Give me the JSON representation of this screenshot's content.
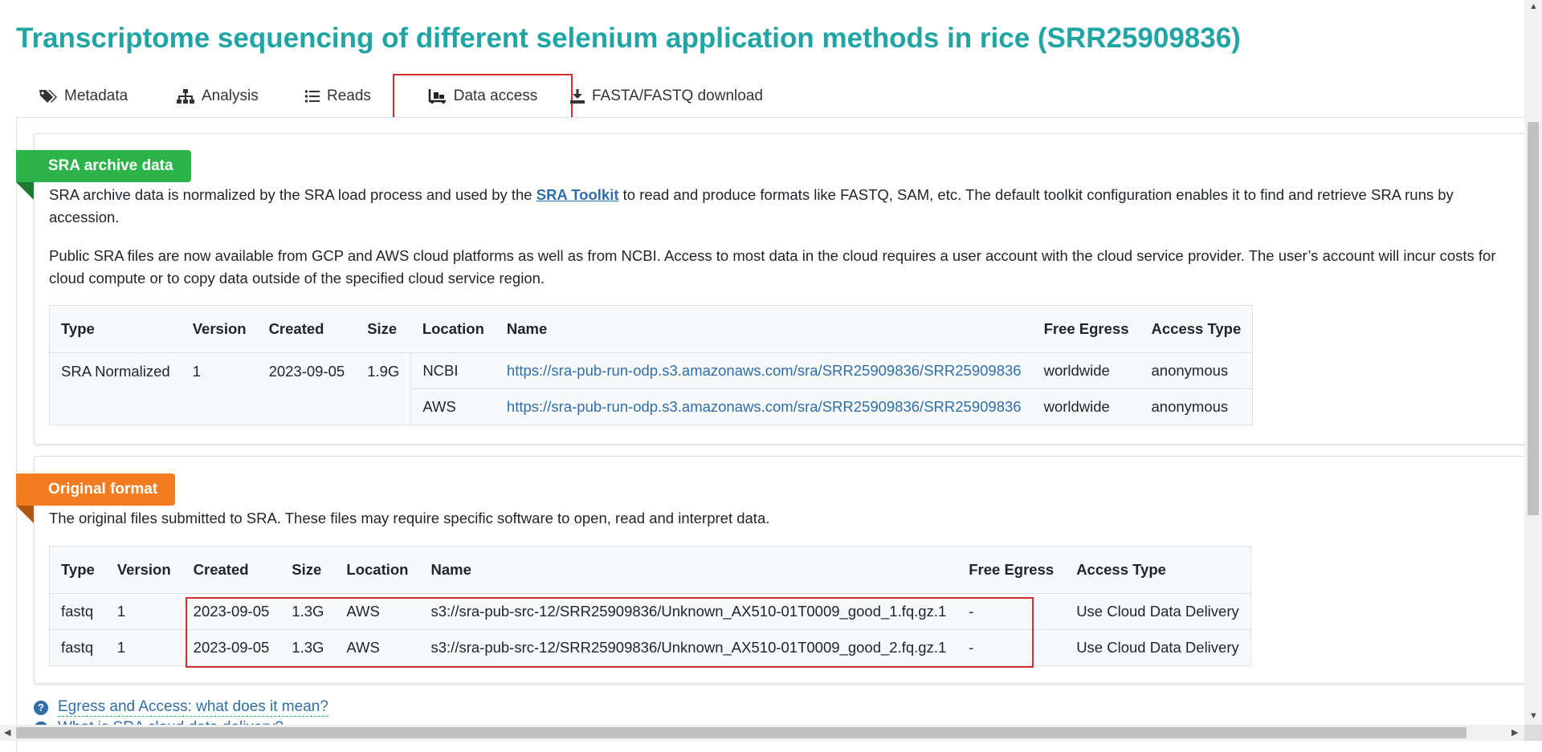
{
  "page": {
    "title": "Transcriptome sequencing of different selenium application methods in rice (SRR25909836)"
  },
  "tabs": [
    {
      "label": "Metadata",
      "icon": "tags-icon"
    },
    {
      "label": "Analysis",
      "icon": "sitemap-icon"
    },
    {
      "label": "Reads",
      "icon": "list-icon"
    },
    {
      "label": "Data access",
      "icon": "dolly-icon",
      "active": true
    },
    {
      "label": "FASTA/FASTQ download",
      "icon": "download-icon"
    }
  ],
  "sra": {
    "badge": "SRA archive data",
    "para1_before": "SRA archive data is normalized by the SRA load process and used by the ",
    "para1_link": "SRA Toolkit",
    "para1_after": " to read and produce formats like FASTQ, SAM, etc. The default toolkit configuration enables it to find and retrieve SRA runs by accession.",
    "para2": "Public SRA files are now available from GCP and AWS cloud platforms as well as from NCBI. Access to most data in the cloud requires a user account with the cloud service provider. The user’s account will incur costs for cloud compute or to copy data outside of the specified cloud service region.",
    "headers": [
      "Type",
      "Version",
      "Created",
      "Size",
      "Location",
      "Name",
      "Free Egress",
      "Access Type"
    ],
    "type": "SRA Normalized",
    "version": "1",
    "created": "2023-09-05",
    "size": "1.9G",
    "rows": [
      {
        "location": "NCBI",
        "name": "https://sra-pub-run-odp.s3.amazonaws.com/sra/SRR25909836/SRR25909836",
        "egress": "worldwide",
        "access": "anonymous"
      },
      {
        "location": "AWS",
        "name": "https://sra-pub-run-odp.s3.amazonaws.com/sra/SRR25909836/SRR25909836",
        "egress": "worldwide",
        "access": "anonymous"
      }
    ]
  },
  "original": {
    "badge": "Original format",
    "para": "The original files submitted to SRA. These files may require specific software to open, read and interpret data.",
    "headers": [
      "Type",
      "Version",
      "Created",
      "Size",
      "Location",
      "Name",
      "Free Egress",
      "Access Type"
    ],
    "rows": [
      {
        "type": "fastq",
        "version": "1",
        "created": "2023-09-05",
        "size": "1.3G",
        "location": "AWS",
        "name": "s3://sra-pub-src-12/SRR25909836/Unknown_AX510-01T0009_good_1.fq.gz.1",
        "egress": "-",
        "access": "Use Cloud Data Delivery"
      },
      {
        "type": "fastq",
        "version": "1",
        "created": "2023-09-05",
        "size": "1.3G",
        "location": "AWS",
        "name": "s3://sra-pub-src-12/SRR25909836/Unknown_AX510-01T0009_good_2.fq.gz.1",
        "egress": "-",
        "access": "Use Cloud Data Delivery"
      }
    ]
  },
  "help": {
    "link1": "Egress and Access: what does it mean?",
    "link2": "What is SRA cloud data delivery?"
  },
  "colors": {
    "title": "#20a4a4",
    "link": "#2f6ea8",
    "green_badge": "#2cb34a",
    "orange_badge": "#f47c20",
    "highlight": "#d32f2f"
  }
}
